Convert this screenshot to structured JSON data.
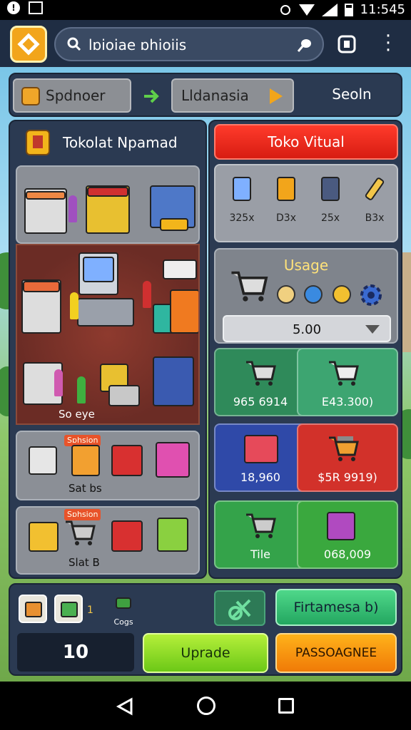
{
  "status_bar": {
    "time": "11:545"
  },
  "app_bar": {
    "search_text": "lɒioiae ɒhioiis"
  },
  "nav": {
    "item1": "Spdnoer",
    "item2": "Lldanasia",
    "item3": "Seoln"
  },
  "left_panel": {
    "title": "Tokolat Npamad",
    "tile3_caption": "So eye",
    "tile4_tag": "Sɒhsion",
    "tile4_caption": "Sat bs",
    "tile5_tag": "Sɒhsion",
    "tile5_caption": "Slat B"
  },
  "right_panel": {
    "header": "Toko Vitual",
    "items": [
      {
        "icon": "server-icon",
        "price": "325x"
      },
      {
        "icon": "machine-icon",
        "price": "D3x"
      },
      {
        "icon": "cabinet-icon",
        "price": "25x"
      },
      {
        "icon": "bar-icon",
        "price": "B3x"
      }
    ],
    "usage": {
      "title": "Usage",
      "dropdown_value": "5.00"
    },
    "cards": [
      {
        "value": "965 6914",
        "color": "#2f8a5a"
      },
      {
        "value": "E43.300)",
        "color": "#3da571"
      },
      {
        "value": "18,960",
        "color": "#2f49a8"
      },
      {
        "value": "$5R 9919)",
        "color": "#d2312a"
      },
      {
        "value": "Tile",
        "color": "#34a34a"
      },
      {
        "value": "068,009",
        "color": "#3aa83e"
      }
    ]
  },
  "bottom_bar": {
    "slot_dot": "1",
    "small_caption": "Cogs",
    "counter": "10",
    "firm_button": "Firtamesa b)",
    "upgrade_button": "Uprade",
    "pass_button": "PASSOAGNEE"
  },
  "colors": {
    "header_red": "#e0241a",
    "upgrade_green": "#8fdc22",
    "pass_orange": "#f8961a",
    "firm_green": "#35c774"
  }
}
